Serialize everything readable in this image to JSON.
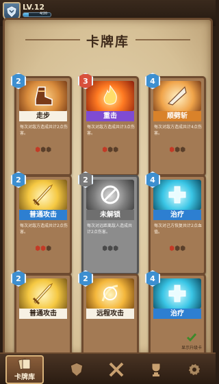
{
  "player": {
    "level_label": "LV.12",
    "xp_text": "4/20",
    "xp_fraction": 0.2
  },
  "screen": {
    "title": "卡牌库"
  },
  "cards": [
    {
      "cost": "2",
      "name": "走步",
      "desc": "每次对敌方造成共计2点伤害。"
    },
    {
      "cost": "3",
      "name": "重击",
      "desc": "每次对敌方造成共计3点伤害。"
    },
    {
      "cost": "4",
      "name": "顺劈斩",
      "desc": "每次对敌方造成共计4点伤害。"
    },
    {
      "cost": "2",
      "name": "普通攻击",
      "desc": "每次对敌方造成共计2点伤害。"
    },
    {
      "cost": "2",
      "name": "未解锁",
      "desc": "每次对远距离敌人造成共计2点伤害。"
    },
    {
      "cost": "4",
      "name": "治疗",
      "desc": "每次对己方恢复共计2点血值。"
    },
    {
      "cost": "2",
      "name": "普通攻击",
      "desc": ""
    },
    {
      "cost": "2",
      "name": "远程攻击",
      "desc": ""
    },
    {
      "cost": "4",
      "name": "治疗",
      "desc": ""
    }
  ],
  "toggle": {
    "show_upgradable_label": "显示升级卡"
  },
  "nav": {
    "tabs": [
      {
        "label": "卡牌库"
      }
    ]
  },
  "icons": [
    "shield-badge-icon",
    "boot-icon",
    "fire-icon",
    "blade-icon",
    "sword-icon",
    "lock-icon",
    "heal-cross-icon",
    "checkmark-icon",
    "cards-icon",
    "crossed-swords-icon",
    "trophy-icon",
    "settings-gear-icon"
  ]
}
